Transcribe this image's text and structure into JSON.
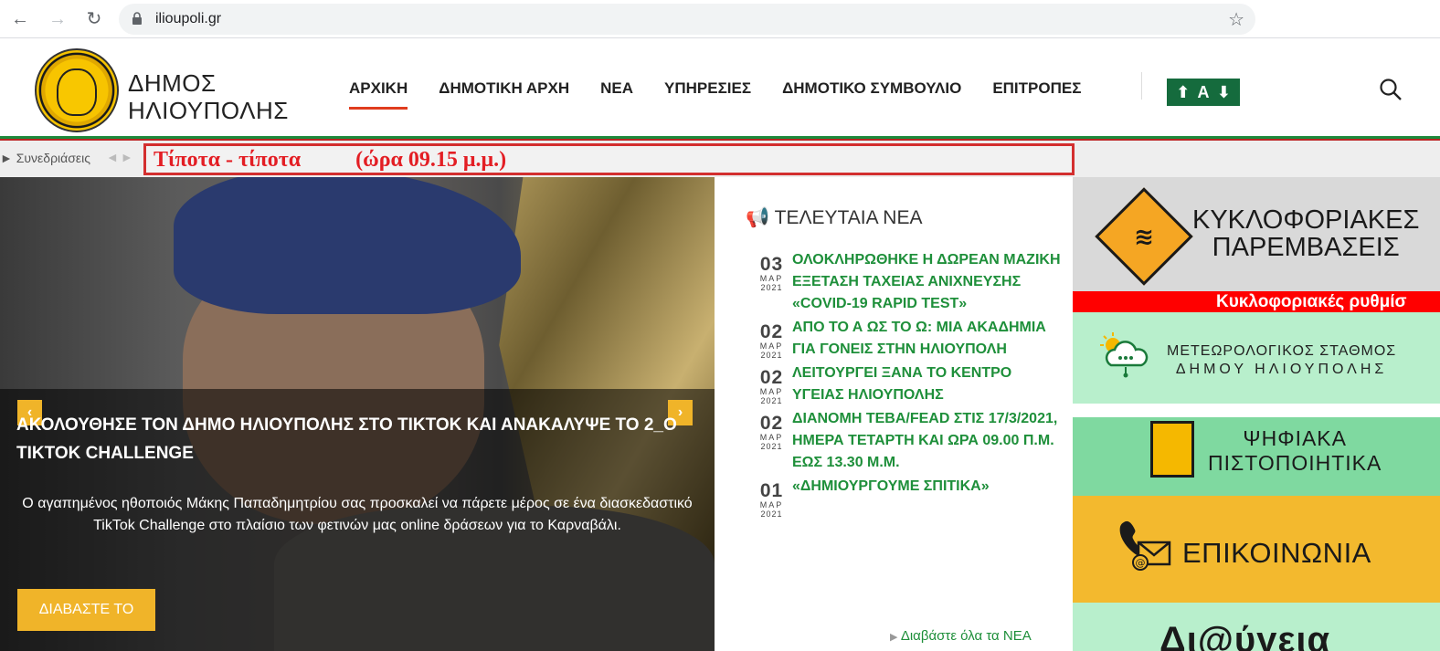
{
  "browser": {
    "url": "ilioupoli.gr"
  },
  "header": {
    "site_name_line1": "ΔΗΜΟΣ",
    "site_name_line2": "ΗΛΙΟΥΠΟΛΗΣ",
    "nav": [
      {
        "label": "ΑΡΧΙΚΗ",
        "active": true
      },
      {
        "label": "ΔΗΜΟΤΙΚΗ ΑΡΧΗ"
      },
      {
        "label": "ΝΕΑ"
      },
      {
        "label": "ΥΠΗΡΕΣΙΕΣ"
      },
      {
        "label": "ΔΗΜΟΤΙΚΟ ΣΥΜΒΟΥΛΙΟ"
      },
      {
        "label": "ΕΠΙΤΡΟΠΕΣ"
      }
    ],
    "accessibility_label": "A",
    "accent_color": "#e03c1e",
    "green_color": "#156b3d"
  },
  "ticker": {
    "label": "Συνεδριάσεις",
    "text": "Τίποτα - τίποτα          (ώρα 09.15 μ.μ.)"
  },
  "hero": {
    "title": "ΑΚΟΛΟΥΘΗΣΕ ΤΟΝ ΔΗΜΟ ΗΛΙΟΥΠΟΛΗΣ ΣΤΟ TIKTOK ΚΑΙ ΑΝΑΚΑΛΥΨΕ ΤΟ 2_Ο TIKTOK CHALLENGE",
    "description": "Ο αγαπημένος ηθοποιός Μάκης Παπαδημητρίου σας προσκαλεί να πάρετε μέρος σε ένα διασκεδαστικό TikTok Challenge στο πλαίσιο των φετινών μας online δράσεων για το Καρναβάλι.",
    "button": "ΔΙΑΒΑΣΤΕ ΤΟ",
    "prev": "‹",
    "next": "›"
  },
  "news": {
    "heading": "ΤΕΛΕΥΤΑΙΑ ΝΕΑ",
    "items": [
      {
        "day": "03",
        "month": "ΜΑΡ",
        "year": "2021",
        "title": "ΟΛΟΚΛΗΡΩΘΗΚΕ Η ΔΩΡΕΑΝ ΜΑΖΙΚΗ ΕΞΕΤΑΣΗ ΤΑΧΕΙΑΣ ΑΝΙΧΝΕΥΣΗΣ «COVID-19 RAPID TEST»"
      },
      {
        "day": "02",
        "month": "ΜΑΡ",
        "year": "2021",
        "title": "ΑΠΟ ΤΟ Α ΩΣ ΤΟ Ω: ΜΙΑ ΑΚΑΔΗΜΙΑ ΓΙΑ ΓΟΝΕΙΣ ΣΤΗΝ ΗΛΙΟΥΠΟΛΗ"
      },
      {
        "day": "02",
        "month": "ΜΑΡ",
        "year": "2021",
        "title": "ΛΕΙΤΟΥΡΓΕΙ ΞΑΝΑ ΤΟ ΚΕΝΤΡΟ ΥΓΕΙΑΣ ΗΛΙΟΥΠΟΛΗΣ"
      },
      {
        "day": "02",
        "month": "ΜΑΡ",
        "year": "2021",
        "title": "ΔΙΑΝΟΜΗ ΤΕΒΑ/FEAD ΣΤΙΣ 17/3/2021, ΗΜΕΡΑ ΤΕΤΑΡΤΗ ΚΑΙ ΩΡΑ 09.00 Π.Μ. ΕΩΣ 13.30 Μ.Μ."
      },
      {
        "day": "01",
        "month": "ΜΑΡ",
        "year": "2021",
        "title": "«ΔΗΜΙΟΥΡΓΟΥΜΕ ΣΠΙΤΙΚΑ»"
      }
    ],
    "more": "Διαβάστε όλα τα ΝΕΑ",
    "link_color": "#1e8f3a"
  },
  "banners": {
    "traffic_line1": "ΚΥΚΛΟΦΟΡΙΑΚΕΣ",
    "traffic_line2": "ΠΑΡΕΜΒΑΣΕΙΣ",
    "marquee": "Κυκλοφοριακές ρυθμίσ",
    "weather_line1": "ΜΕΤΕΩΡΟΛΟΓΙΚΟΣ ΣΤΑΘΜΟΣ",
    "weather_line2": "ΔΗΜΟΥ ΗΛΙΟΥΠΟΛΗΣ",
    "certs_line1": "ΨΗΦΙΑΚΑ",
    "certs_line2": "ΠΙΣΤΟΠΟΙΗΤΙΚΑ",
    "contact": "ΕΠΙΚΟΙΝΩΝΙΑ",
    "diavgeia": "Δι@ύγεια"
  }
}
